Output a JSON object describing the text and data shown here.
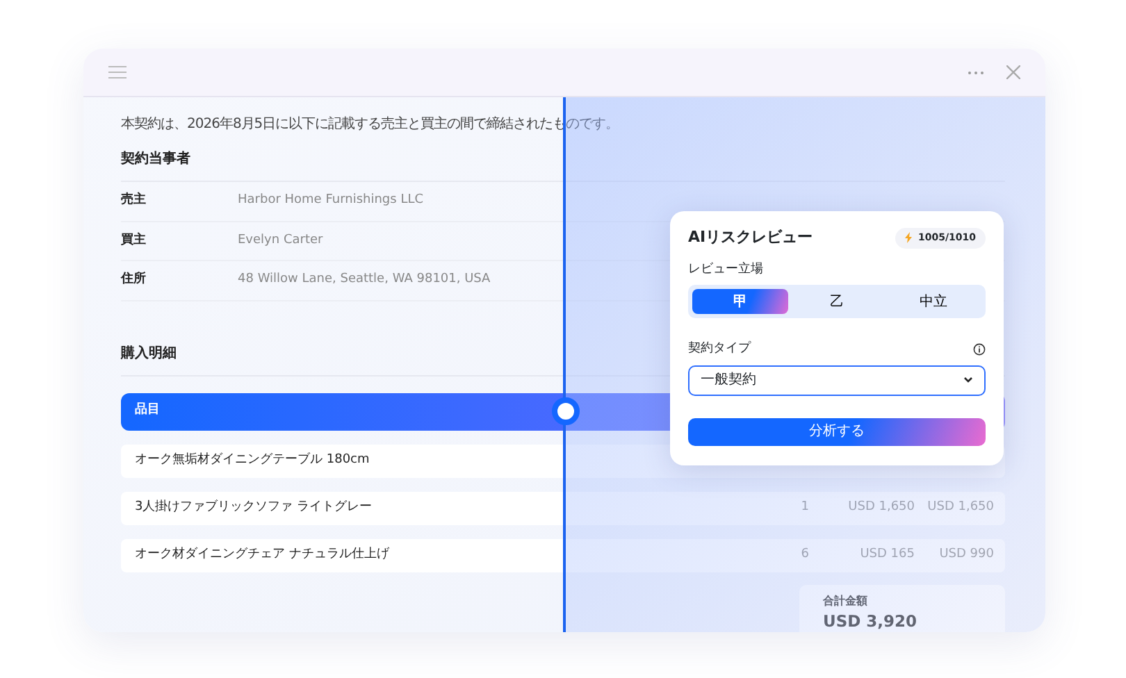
{
  "intro": "本契約は、2026年8月5日に以下に記載する売主と買主の間で締結されたものです。",
  "parties": {
    "title": "契約当事者",
    "rows": [
      {
        "label": "売主",
        "value": "Harbor Home Furnishings LLC"
      },
      {
        "label": "買主",
        "value": "Evelyn Carter"
      },
      {
        "label": "住所",
        "value": "48 Willow Lane, Seattle, WA 98101, USA"
      }
    ]
  },
  "purchase": {
    "title": "購入明細",
    "header": "品目",
    "rows": [
      {
        "name": "オーク無垢材ダイニングテーブル 180cm",
        "cells": []
      },
      {
        "name": "3人掛けファブリックソファ ライトグレー",
        "cells": [
          "1",
          "USD 1,650",
          "USD 1,650"
        ]
      },
      {
        "name": "オーク材ダイニングチェア ナチュラル仕上げ",
        "cells": [
          "6",
          "USD 165",
          "USD 990"
        ]
      }
    ],
    "total_label": "合計金額",
    "total": "USD 3,920"
  },
  "compare_slider": {
    "level": 0.5
  },
  "review": {
    "title": "AIリスクレビュー",
    "credits": "1005/1010",
    "stance_label": "レビュー立場",
    "stances": [
      {
        "label": "甲",
        "selected": true
      },
      {
        "label": "乙",
        "selected": false
      },
      {
        "label": "中立",
        "selected": false
      }
    ],
    "type_label": "契約タイプ",
    "type_value": "一般契約",
    "button": "分析する"
  }
}
